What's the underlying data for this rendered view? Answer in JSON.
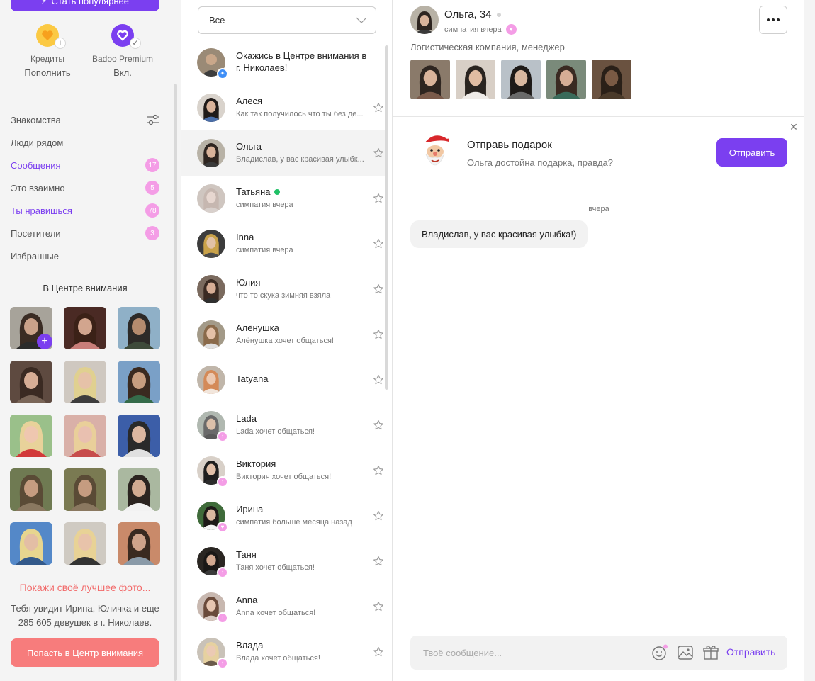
{
  "sidebar": {
    "popular_button": "Стать популярнее",
    "wallet": {
      "credits_label": "Кредиты",
      "credits_action": "Пополнить",
      "premium_label": "Badoo Premium",
      "premium_status": "Вкл."
    },
    "nav": [
      {
        "label": "Знакомства",
        "badge": null,
        "active": false
      },
      {
        "label": "Люди рядом",
        "badge": null,
        "active": false
      },
      {
        "label": "Сообщения",
        "badge": "17",
        "active": true
      },
      {
        "label": "Это взаимно",
        "badge": "5",
        "active": false
      },
      {
        "label": "Ты нравишься",
        "badge": "78",
        "active": true
      },
      {
        "label": "Посетители",
        "badge": "3",
        "active": false
      },
      {
        "label": "Избранные",
        "badge": null,
        "active": false
      }
    ],
    "spotlight_title": "В Центре внимания",
    "promo_link": "Покажи своё лучшее фото...",
    "promo_text": "Тебя увидит Ирина, Юличка и еще 285 605 девушек в г. Николаев.",
    "promo_button": "Попасть в Центр внимания"
  },
  "list": {
    "filter_value": "Все",
    "spotlight_row": "Окажись в Центре внимания в г. Николаев!",
    "conversations": [
      {
        "name": "Алеся",
        "preview": "Как так получилось что ты без де...",
        "online": false,
        "badge": ""
      },
      {
        "name": "Ольга",
        "preview": "Владислав, у вас красивая улыбк...",
        "online": false,
        "badge": "",
        "active": true
      },
      {
        "name": "Татьяна",
        "preview": "симпатия вчера",
        "online": true,
        "badge": ""
      },
      {
        "name": "Inna",
        "preview": "симпатия вчера",
        "online": false,
        "badge": ""
      },
      {
        "name": "Юлия",
        "preview": "что то скука зимняя взяла",
        "online": false,
        "badge": ""
      },
      {
        "name": "Алёнушка",
        "preview": "Алёнушка хочет общаться!",
        "online": false,
        "badge": ""
      },
      {
        "name": "Tatyana",
        "preview": "",
        "online": false,
        "badge": ""
      },
      {
        "name": "Lada",
        "preview": "Lada хочет общаться!",
        "online": false,
        "badge": "pink"
      },
      {
        "name": "Виктория",
        "preview": "Виктория хочет общаться!",
        "online": false,
        "badge": "pink"
      },
      {
        "name": "Ирина",
        "preview": "симпатия больше месяца назад",
        "online": false,
        "badge": "pink"
      },
      {
        "name": "Таня",
        "preview": "Таня хочет общаться!",
        "online": false,
        "badge": "pink"
      },
      {
        "name": "Anna",
        "preview": "Anna хочет общаться!",
        "online": false,
        "badge": "pink"
      },
      {
        "name": "Влада",
        "preview": "Влада хочет общаться!",
        "online": false,
        "badge": "pink"
      }
    ]
  },
  "chat": {
    "name": "Ольга, 34",
    "status": "симпатия вчера",
    "job": "Логистическая компания, менеджер",
    "gift_title": "Отправь подарок",
    "gift_subtitle": "Ольга достойна подарка, правда?",
    "gift_button": "Отправить",
    "day_label": "вчера",
    "message": "Владислав, у вас красивая улыбка!)",
    "composer_placeholder": "Твоё сообщение...",
    "send_label": "Отправить"
  },
  "colors": {
    "accent": "#7b3ff0",
    "badge_pink": "#f49de6",
    "promo_red": "#f77c7c",
    "online_green": "#21c167"
  }
}
